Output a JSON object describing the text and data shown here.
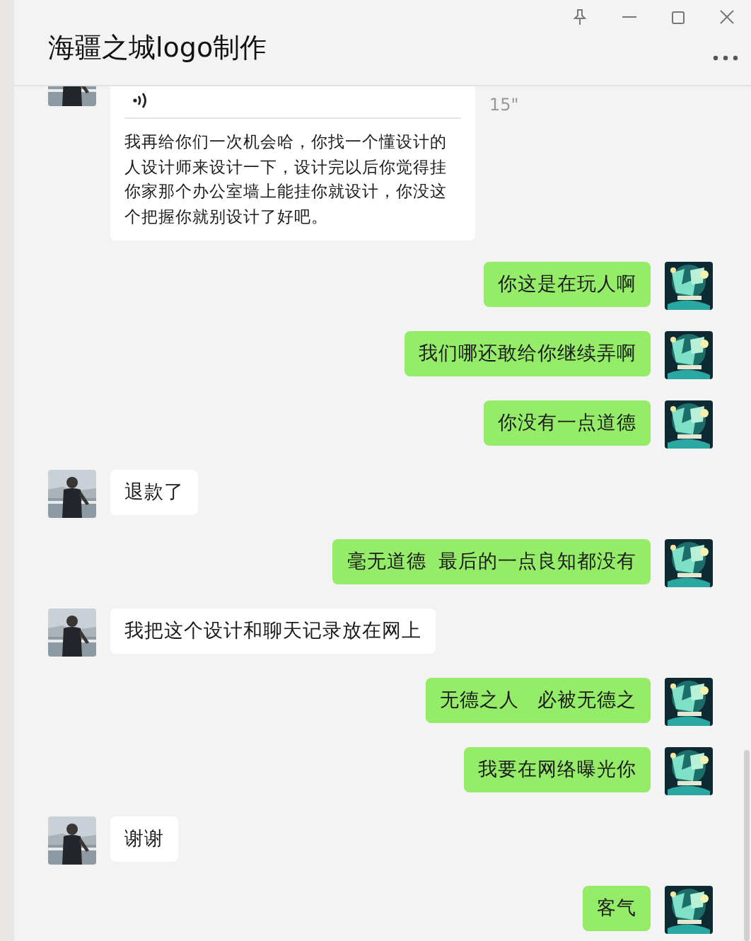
{
  "window": {
    "title": "海疆之城logo制作"
  },
  "messages": [
    {
      "outgoing": false,
      "kind": "voice",
      "duration": "15\"",
      "transcript": "我再给你们一次机会哈，你找一个懂设计的人设计师来设计一下，设计完以后你觉得挂你家那个办公室墙上能挂你就设计，你没这个把握你就别设计了好吧。"
    },
    {
      "outgoing": true,
      "kind": "text",
      "text": "你这是在玩人啊"
    },
    {
      "outgoing": true,
      "kind": "text",
      "text": "我们哪还敢给你继续弄啊"
    },
    {
      "outgoing": true,
      "kind": "text",
      "text": "你没有一点道德"
    },
    {
      "outgoing": false,
      "kind": "text",
      "text": "退款了"
    },
    {
      "outgoing": true,
      "kind": "text",
      "text": "毫无道德  最后的一点良知都没有"
    },
    {
      "outgoing": false,
      "kind": "text",
      "text": "我把这个设计和聊天记录放在网上"
    },
    {
      "outgoing": true,
      "kind": "text",
      "text": "无德之人   必被无德之"
    },
    {
      "outgoing": true,
      "kind": "text",
      "text": "我要在网络曝光你"
    },
    {
      "outgoing": false,
      "kind": "text",
      "text": "谢谢"
    },
    {
      "outgoing": true,
      "kind": "text",
      "text": "客气"
    }
  ]
}
